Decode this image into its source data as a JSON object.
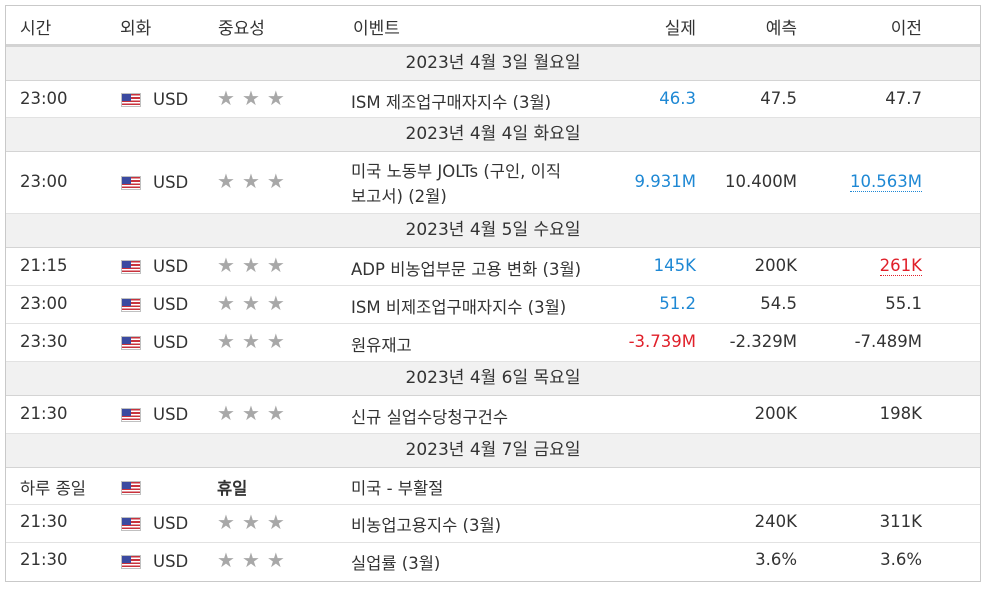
{
  "header": {
    "time": "시간",
    "currency": "외화",
    "importance": "중요성",
    "event": "이벤트",
    "actual": "실제",
    "forecast": "예측",
    "previous": "이전"
  },
  "colors": {
    "positive": "#1e88d4",
    "negative": "#e0202a",
    "date_band": "#f1f1f1"
  },
  "icons": {
    "star": "star-icon",
    "flag": "us-flag-icon"
  },
  "days": [
    {
      "date": "2023년 4월 3일 월요일",
      "events": [
        {
          "time": "23:00",
          "currency": "USD",
          "stars": 3,
          "event": "ISM 제조업구매자지수 (3월)",
          "actual": "46.3",
          "forecast": "47.5",
          "previous": "47.7"
        }
      ]
    },
    {
      "date": "2023년 4월 4일 화요일",
      "events": [
        {
          "time": "23:00",
          "currency": "USD",
          "stars": 3,
          "event_line1": "미국 노동부 JOLTs (구인, 이직",
          "event_line2": "보고서) (2월)",
          "actual": "9.931M",
          "forecast": "10.400M",
          "previous": "10.563M"
        }
      ]
    },
    {
      "date": "2023년 4월 5일 수요일",
      "events": [
        {
          "time": "21:15",
          "currency": "USD",
          "stars": 3,
          "event": "ADP 비농업부문 고용 변화 (3월)",
          "actual": "145K",
          "forecast": "200K",
          "previous": "261K"
        },
        {
          "time": "23:00",
          "currency": "USD",
          "stars": 3,
          "event": "ISM 비제조업구매자지수 (3월)",
          "actual": "51.2",
          "forecast": "54.5",
          "previous": "55.1"
        },
        {
          "time": "23:30",
          "currency": "USD",
          "stars": 3,
          "event": "원유재고",
          "actual": "-3.739M",
          "forecast": "-2.329M",
          "previous": "-7.489M"
        }
      ]
    },
    {
      "date": "2023년 4월 6일 목요일",
      "events": [
        {
          "time": "21:30",
          "currency": "USD",
          "stars": 3,
          "event": "신규 실업수당청구건수",
          "actual": "",
          "forecast": "200K",
          "previous": "198K"
        }
      ]
    },
    {
      "date": "2023년 4월 7일 금요일",
      "events": [
        {
          "time": "하루 종일",
          "currency": "",
          "holiday_label": "휴일",
          "event": "미국 - 부활절"
        },
        {
          "time": "21:30",
          "currency": "USD",
          "stars": 3,
          "event": "비농업고용지수 (3월)",
          "actual": "",
          "forecast": "240K",
          "previous": "311K"
        },
        {
          "time": "21:30",
          "currency": "USD",
          "stars": 3,
          "event": "실업률 (3월)",
          "actual": "",
          "forecast": "3.6%",
          "previous": "3.6%"
        }
      ]
    }
  ]
}
